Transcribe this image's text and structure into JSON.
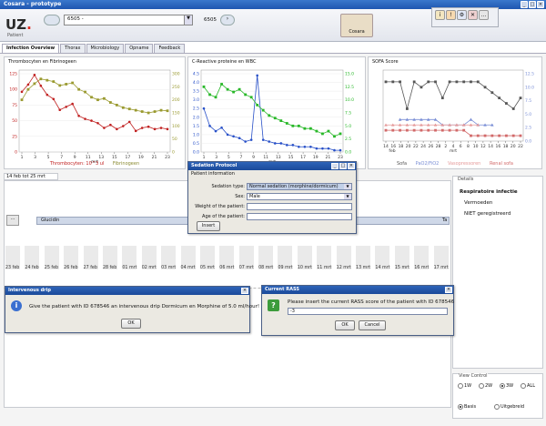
{
  "window": {
    "title": "Cosara - prototype"
  },
  "toolbar": {
    "patient_select_value": "6505 -",
    "patient_label": "Patient",
    "id_code": "6505",
    "cosara_label": "Cosara"
  },
  "tabs": [
    {
      "label": "Infection Overview"
    },
    {
      "label": "Thorax"
    },
    {
      "label": "Microbiology"
    },
    {
      "label": "Opname"
    },
    {
      "label": "Feedback"
    }
  ],
  "charts": [
    {
      "title": "Thrombocyten en Fibrinogeen",
      "x_label": "mrt",
      "x_ticks": [
        "1",
        "3",
        "5",
        "7",
        "9",
        "11",
        "13",
        "15",
        "17",
        "19",
        "21",
        "23"
      ],
      "y_left_ticks": [
        "0",
        "25",
        "50",
        "75",
        "100",
        "125"
      ],
      "y_right_ticks": [
        "0",
        "50",
        "100",
        "150",
        "200",
        "250",
        "300"
      ],
      "legend": [
        {
          "name": "Thrombocyten: 10^3 ul",
          "color": "#c02020"
        },
        {
          "name": "Fibrinogeen",
          "color": "#8a8a30"
        }
      ]
    },
    {
      "title": "C-Reactive proteine en WBC",
      "x_label": "mrt",
      "x_ticks": [
        "1",
        "3",
        "5",
        "7",
        "9",
        "11",
        "13",
        "15",
        "17",
        "19",
        "21",
        "23"
      ],
      "y_left_ticks": [
        "0.0",
        "0.5",
        "1.0",
        "1.5",
        "2.0",
        "2.5",
        "3.0",
        "3.5",
        "4.0",
        "4.5"
      ],
      "y_right_ticks": [
        "0.0",
        "2.5",
        "5.0",
        "7.5",
        "10.0",
        "12.5",
        "15.0"
      ],
      "legend": []
    },
    {
      "title": "SOFA Score",
      "x_label": "mrt",
      "x_ticks": [
        "14",
        "16",
        "18",
        "20",
        "22",
        "24",
        "26",
        "28",
        "2",
        "4",
        "6",
        "8",
        "10",
        "12",
        "14",
        "16",
        "18",
        "20",
        "22"
      ],
      "x_label_feb": "feb",
      "y_right_ticks": [
        "0.0",
        "2.5",
        "5.0",
        "7.5",
        "10.0",
        "12.5"
      ],
      "legend": [
        {
          "name": "Sofa",
          "color": "#555555"
        },
        {
          "name": "PaO2/FiO2",
          "color": "#7b8fd6"
        },
        {
          "name": "Vasopressoren",
          "color": "#e59a9a"
        },
        {
          "name": "Renal sofa",
          "color": "#d26a6a"
        }
      ]
    }
  ],
  "chart_data": [
    {
      "type": "line",
      "title": "Thrombocyten en Fibrinogeen",
      "x": [
        1,
        2,
        3,
        4,
        5,
        6,
        7,
        8,
        9,
        10,
        11,
        12,
        13,
        14,
        15,
        16,
        17,
        18,
        19,
        20,
        21,
        22,
        23,
        24
      ],
      "series": [
        {
          "name": "Thrombocyten: 10^3 ul",
          "axis": "left",
          "values": [
            100,
            112,
            128,
            110,
            95,
            88,
            70,
            75,
            80,
            60,
            55,
            52,
            48,
            40,
            45,
            38,
            43,
            50,
            35,
            40,
            42,
            38,
            40,
            38
          ]
        },
        {
          "name": "Fibrinogeen",
          "axis": "right",
          "values": [
            200,
            240,
            262,
            280,
            275,
            270,
            255,
            260,
            265,
            240,
            230,
            210,
            200,
            205,
            190,
            180,
            170,
            165,
            160,
            155,
            150,
            155,
            160,
            158
          ]
        }
      ],
      "ylim_left": [
        0,
        130
      ],
      "ylim_right": [
        0,
        300
      ]
    },
    {
      "type": "line",
      "title": "C-Reactive proteine en WBC",
      "x": [
        1,
        2,
        3,
        4,
        5,
        6,
        7,
        8,
        9,
        10,
        11,
        12,
        13,
        14,
        15,
        16,
        17,
        18,
        19,
        20,
        21,
        22,
        23,
        24
      ],
      "series": [
        {
          "axis": "left",
          "values": [
            2.5,
            1.5,
            1.2,
            1.4,
            1.0,
            0.9,
            0.8,
            0.6,
            0.7,
            4.4,
            0.7,
            0.6,
            0.5,
            0.5,
            0.4,
            0.4,
            0.3,
            0.3,
            0.3,
            0.2,
            0.2,
            0.2,
            0.1,
            0.1
          ]
        },
        {
          "axis": "right",
          "values": [
            12.5,
            11.0,
            10.5,
            13.0,
            12.0,
            11.5,
            12.0,
            11.0,
            10.5,
            9.0,
            8.0,
            7.0,
            6.5,
            6.0,
            5.5,
            5.0,
            5.0,
            4.5,
            4.5,
            4.0,
            3.5,
            4.0,
            3.0,
            3.5
          ]
        }
      ],
      "ylim_left": [
        0,
        4.5
      ],
      "ylim_right": [
        0,
        15
      ]
    },
    {
      "type": "line",
      "title": "SOFA Score",
      "x": [
        1,
        2,
        3,
        4,
        5,
        6,
        7,
        8,
        9,
        10,
        11,
        12,
        13,
        14,
        15,
        16,
        17,
        18,
        19,
        20
      ],
      "series": [
        {
          "name": "Sofa",
          "values": [
            11,
            11,
            11,
            6,
            11,
            10,
            11,
            11,
            8,
            11,
            11,
            11,
            11,
            11,
            10,
            9,
            8,
            7,
            6,
            8
          ]
        },
        {
          "name": "PaO2/FiO2",
          "values": [
            null,
            null,
            4,
            4,
            4,
            4,
            4,
            4,
            3,
            3,
            3,
            3,
            4,
            3,
            3,
            3,
            null,
            null,
            null,
            null
          ]
        },
        {
          "name": "Vasopressoren",
          "values": [
            3,
            3,
            3,
            3,
            3,
            3,
            3,
            3,
            3,
            3,
            3,
            3,
            3,
            3,
            null,
            null,
            null,
            null,
            null,
            null
          ]
        },
        {
          "name": "Renal sofa",
          "values": [
            2,
            2,
            2,
            2,
            2,
            2,
            2,
            2,
            2,
            2,
            2,
            2,
            1,
            1,
            1,
            1,
            1,
            1,
            1,
            1
          ]
        }
      ],
      "ylim": [
        0,
        12.5
      ]
    }
  ],
  "timeline": {
    "range_label": "14 feb tot 25 mrt",
    "expand_label": "...",
    "drug_label": "Glucidin",
    "drug_tail": "Ta",
    "dates": [
      "23 feb",
      "24 feb",
      "25 feb",
      "26 feb",
      "27 feb",
      "28 feb",
      "01 mrt",
      "02 mrt",
      "03 mrt",
      "04 mrt",
      "05 mrt",
      "06 mrt",
      "07 mrt",
      "08 mrt",
      "09 mrt",
      "10 mrt",
      "11 mrt",
      "12 mrt",
      "13 mrt",
      "14 mrt",
      "15 mrt",
      "16 mrt",
      "17 mrt"
    ]
  },
  "details": {
    "title": "Details",
    "heading": "Respiratoire infectie",
    "line1": "Vermoeden",
    "line2": "NIET geregistreerd"
  },
  "view_control": {
    "title": "View Control",
    "options": [
      "1W",
      "2W",
      "3W",
      "ALL"
    ],
    "selected": "3W",
    "mode_options": [
      "Basis",
      "Uitgebreid"
    ],
    "mode_selected": "Basis"
  },
  "sedation_dialog": {
    "title": "Sedation Protocol",
    "section": "Patient information",
    "sedation_type_label": "Sedation type:",
    "sedation_type_value": "Normal sedation (morphine/dormicum)",
    "sex_label": "Sex:",
    "sex_value": "Male",
    "weight_label": "Weight of the patient:",
    "age_label": "Age of the patient:",
    "insert_label": "Insert"
  },
  "drip_dialog": {
    "title": "Intervenous drip",
    "message": "Give the patient with ID 678546 an intervenous drip Dormicum en Morphine of 5.0 ml/hour!",
    "ok_label": "OK"
  },
  "rass_dialog": {
    "title": "Current RASS",
    "message": "Please insert the current RASS score of the patient with ID 678546",
    "input_value": "-3",
    "ok_label": "OK",
    "cancel_label": "Cancel"
  },
  "colors": {
    "accent": "#1f56b0",
    "thrombo": "#c02020",
    "fibrin": "#9a9a30",
    "crp": "#2850c8",
    "wbc": "#28b828",
    "sofa": "#555555",
    "pao2": "#7b8fd6",
    "vaso": "#e59a9a",
    "renal": "#d26a6a"
  }
}
